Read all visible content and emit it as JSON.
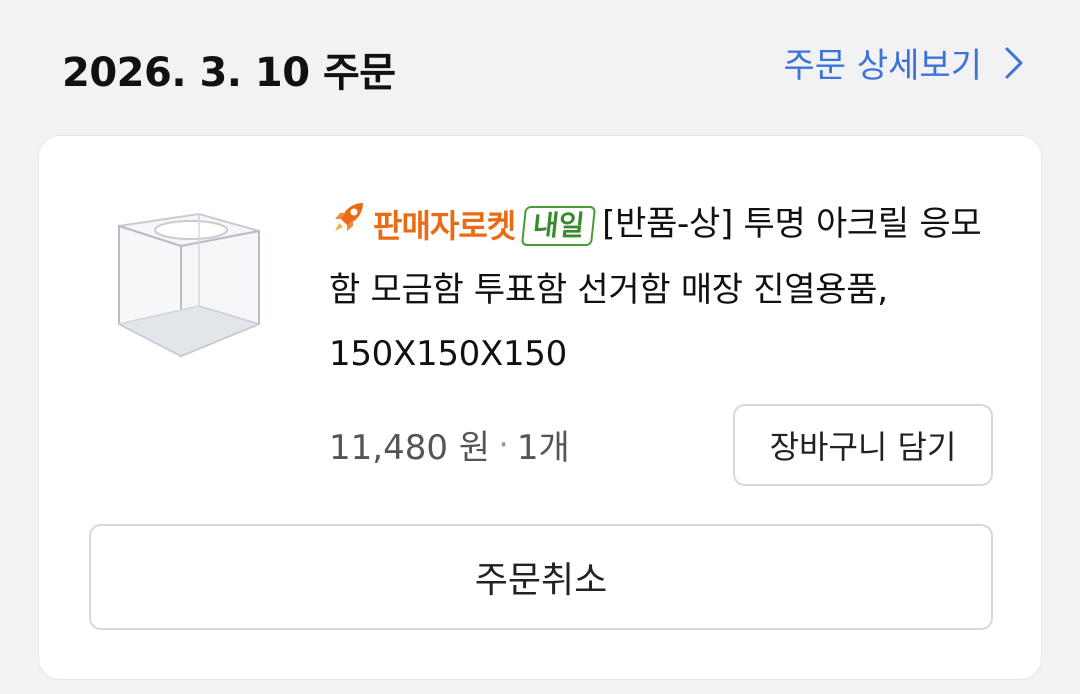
{
  "order": {
    "date_label": "2026. 3. 10 주문",
    "detail_link_label": "주문 상세보기"
  },
  "item": {
    "rocket_badge_label": "판매자로켓",
    "arrival_badge_label": "내일",
    "title": "[반품-상] 투명 아크릴 응모함 모금함 투표함 선거함 매장 진열용품, 150X150X150",
    "price": "11,480 원",
    "separator": "·",
    "quantity": "1개",
    "rocket_color": "#ea6b15",
    "arrival_color": "#3a8a2a"
  },
  "actions": {
    "add_to_cart_label": "장바구니 담기",
    "cancel_order_label": "주문취소"
  },
  "colors": {
    "link": "#3b73d6"
  }
}
